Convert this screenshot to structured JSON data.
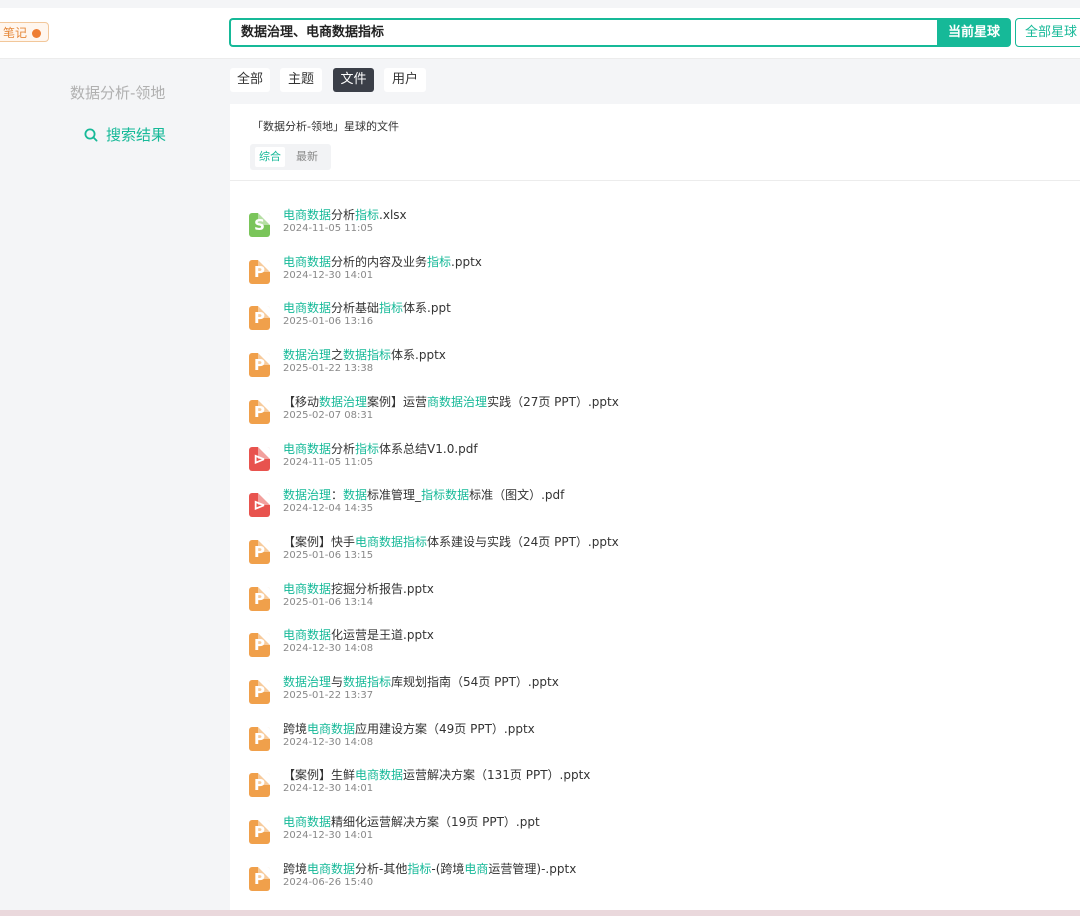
{
  "header": {
    "badge_label": "笔记",
    "search_value": "数据治理、电商数据指标",
    "current_planet_button": "当前星球",
    "all_planets_button": "全部星球"
  },
  "sidebar": {
    "title": "数据分析-领地",
    "search_results_label": "搜索结果"
  },
  "tabs": [
    "全部",
    "主题",
    "文件",
    "用户"
  ],
  "active_tab": "文件",
  "panel": {
    "title": "「数据分析-领地」星球的文件",
    "subtabs": [
      "综合",
      "最新"
    ],
    "active_subtab": "综合"
  },
  "colors": {
    "accent": "#16b998",
    "dark_tab": "#3b3f48",
    "ppt_icon": "#f0a04b",
    "pdf_icon": "#e8534e",
    "xls_icon": "#7ac55a"
  },
  "files": [
    {
      "type": "xls",
      "icon": "spreadsheet-icon",
      "segments": [
        [
          "电商数据",
          1
        ],
        [
          "分析",
          0
        ],
        [
          "指标",
          1
        ],
        [
          ".xlsx",
          0
        ]
      ],
      "date": "2024-11-05 11:05"
    },
    {
      "type": "ppt",
      "icon": "presentation-icon",
      "segments": [
        [
          "电商数据",
          1
        ],
        [
          "分析的内容及业务",
          0
        ],
        [
          "指标",
          1
        ],
        [
          ".pptx",
          0
        ]
      ],
      "date": "2024-12-30 14:01"
    },
    {
      "type": "ppt",
      "icon": "presentation-icon",
      "segments": [
        [
          "电商数据",
          1
        ],
        [
          "分析基础",
          0
        ],
        [
          "指标",
          1
        ],
        [
          "体系.ppt",
          0
        ]
      ],
      "date": "2025-01-06 13:16"
    },
    {
      "type": "ppt",
      "icon": "presentation-icon",
      "segments": [
        [
          "数据治理",
          1
        ],
        [
          "之",
          0
        ],
        [
          "数据指标",
          1
        ],
        [
          "体系.pptx",
          0
        ]
      ],
      "date": "2025-01-22 13:38"
    },
    {
      "type": "ppt",
      "icon": "presentation-icon",
      "segments": [
        [
          "【移动",
          0
        ],
        [
          "数据治理",
          1
        ],
        [
          "案例】运营",
          0
        ],
        [
          "商数据治理",
          1
        ],
        [
          "实践（27页 PPT）.pptx",
          0
        ]
      ],
      "date": "2025-02-07 08:31"
    },
    {
      "type": "pdf",
      "icon": "pdf-icon",
      "segments": [
        [
          "电商数据",
          1
        ],
        [
          "分析",
          0
        ],
        [
          "指标",
          1
        ],
        [
          "体系总结V1.0.pdf",
          0
        ]
      ],
      "date": "2024-11-05 11:05"
    },
    {
      "type": "pdf",
      "icon": "pdf-icon",
      "segments": [
        [
          "数据治理",
          1
        ],
        [
          "：",
          0
        ],
        [
          "数据",
          1
        ],
        [
          "标准管理_",
          0
        ],
        [
          "指标数据",
          1
        ],
        [
          "标准（图文）.pdf",
          0
        ]
      ],
      "date": "2024-12-04 14:35"
    },
    {
      "type": "ppt",
      "icon": "presentation-icon",
      "segments": [
        [
          "【案例】快手",
          0
        ],
        [
          "电商数据指标",
          1
        ],
        [
          "体系建设与实践（24页 PPT）.pptx",
          0
        ]
      ],
      "date": "2025-01-06 13:15"
    },
    {
      "type": "ppt",
      "icon": "presentation-icon",
      "segments": [
        [
          "电商数据",
          1
        ],
        [
          "挖掘分析报告.pptx",
          0
        ]
      ],
      "date": "2025-01-06 13:14"
    },
    {
      "type": "ppt",
      "icon": "presentation-icon",
      "segments": [
        [
          "电商数据",
          1
        ],
        [
          "化运营是王道.pptx",
          0
        ]
      ],
      "date": "2024-12-30 14:08"
    },
    {
      "type": "ppt",
      "icon": "presentation-icon",
      "segments": [
        [
          "数据治理",
          1
        ],
        [
          "与",
          0
        ],
        [
          "数据指标",
          1
        ],
        [
          "库规划指南（54页 PPT）.pptx",
          0
        ]
      ],
      "date": "2025-01-22 13:37"
    },
    {
      "type": "ppt",
      "icon": "presentation-icon",
      "segments": [
        [
          "跨境",
          0
        ],
        [
          "电商数据",
          1
        ],
        [
          "应用建设方案（49页 PPT）.pptx",
          0
        ]
      ],
      "date": "2024-12-30 14:08"
    },
    {
      "type": "ppt",
      "icon": "presentation-icon",
      "segments": [
        [
          "【案例】生鲜",
          0
        ],
        [
          "电商数据",
          1
        ],
        [
          "运营解决方案（131页 PPT）.pptx",
          0
        ]
      ],
      "date": "2024-12-30 14:01"
    },
    {
      "type": "ppt",
      "icon": "presentation-icon",
      "segments": [
        [
          "电商数据",
          1
        ],
        [
          "精细化运营解决方案（19页 PPT）.ppt",
          0
        ]
      ],
      "date": "2024-12-30 14:01"
    },
    {
      "type": "ppt",
      "icon": "presentation-icon",
      "segments": [
        [
          "跨境",
          0
        ],
        [
          "电商数据",
          1
        ],
        [
          "分析-其他",
          0
        ],
        [
          "指标",
          1
        ],
        [
          "-(跨境",
          0
        ],
        [
          "电商",
          1
        ],
        [
          "运营管理)-.pptx",
          0
        ]
      ],
      "date": "2024-06-26 15:40"
    }
  ]
}
